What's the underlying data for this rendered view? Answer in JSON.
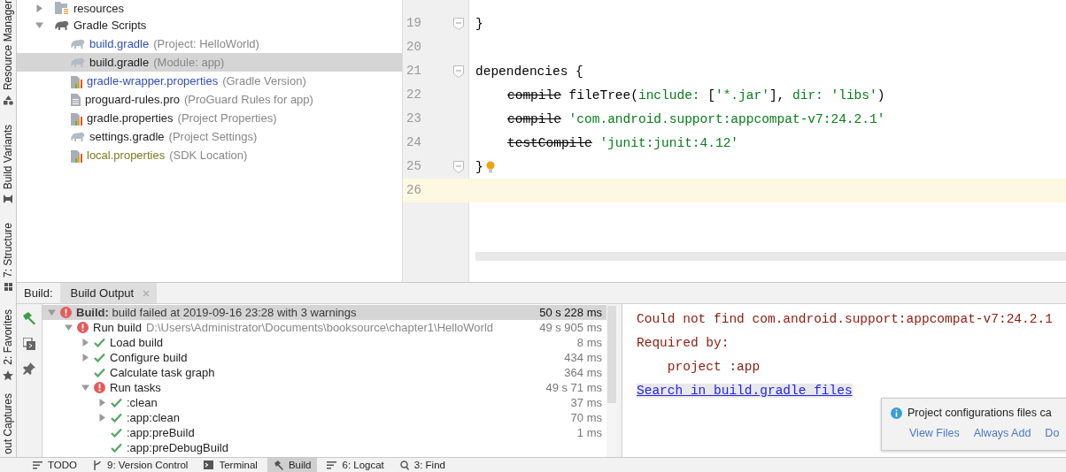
{
  "tool_strip": {
    "top": [
      {
        "label": "Resource Manager"
      },
      {
        "label": "Build Variants"
      },
      {
        "label": "7: Structure"
      }
    ],
    "bottom": [
      {
        "label": "2: Favorites"
      },
      {
        "label": "out Captures"
      }
    ]
  },
  "project_tree": [
    {
      "kind": "folder",
      "name": "resources",
      "expanded": false,
      "selected": false
    },
    {
      "kind": "group",
      "name": "Gradle Scripts",
      "expanded": true,
      "selected": false,
      "children": [
        {
          "kind": "gradle",
          "name": "build.gradle",
          "hint": "(Project: HelloWorld)",
          "color": "#2f4fb8",
          "selected": false
        },
        {
          "kind": "gradle",
          "name": "build.gradle",
          "hint": "(Module: app)",
          "color": "#222222",
          "selected": true
        },
        {
          "kind": "properties",
          "name": "gradle-wrapper.properties",
          "hint": "(Gradle Version)",
          "color": "#2f4fb8",
          "selected": false
        },
        {
          "kind": "text",
          "name": "proguard-rules.pro",
          "hint": "(ProGuard Rules for app)",
          "color": "#222222",
          "selected": false
        },
        {
          "kind": "properties",
          "name": "gradle.properties",
          "hint": "(Project Properties)",
          "color": "#222222",
          "selected": false
        },
        {
          "kind": "gradle",
          "name": "settings.gradle",
          "hint": "(Project Settings)",
          "color": "#222222",
          "selected": false
        },
        {
          "kind": "properties",
          "name": "local.properties",
          "hint": "(SDK Location)",
          "color": "#7d7a1f",
          "selected": false
        }
      ]
    }
  ],
  "editor": {
    "lines": [
      {
        "number": "19",
        "fold": true,
        "bulb": false,
        "current": false,
        "tokens": [
          {
            "kind": "plain",
            "text": "}"
          }
        ]
      },
      {
        "number": "20",
        "fold": false,
        "bulb": false,
        "current": false
      },
      {
        "number": "21",
        "fold": true,
        "bulb": false,
        "current": false,
        "tokens": [
          {
            "kind": "plain",
            "text": "dependencies {"
          }
        ]
      },
      {
        "number": "22",
        "fold": false,
        "bulb": false,
        "current": false,
        "indented": true,
        "tokens": [
          {
            "kind": "deprecated",
            "text": "compile"
          },
          {
            "kind": "plain",
            "text": " fileTree("
          },
          {
            "kind": "string",
            "text": "include: "
          },
          {
            "kind": "plain",
            "text": "["
          },
          {
            "kind": "string",
            "text": "'*.jar'"
          },
          {
            "kind": "plain",
            "text": "], "
          },
          {
            "kind": "string",
            "text": "dir: 'libs'"
          },
          {
            "kind": "plain",
            "text": ")"
          }
        ]
      },
      {
        "number": "23",
        "fold": false,
        "bulb": false,
        "current": false,
        "indented": true,
        "tokens": [
          {
            "kind": "deprecated",
            "text": "compile"
          },
          {
            "kind": "string",
            "text": " 'com.android.support:appcompat-v7:24.2.1'"
          }
        ]
      },
      {
        "number": "24",
        "fold": false,
        "bulb": false,
        "current": false,
        "indented": true,
        "tokens": [
          {
            "kind": "deprecated",
            "text": "testCompile"
          },
          {
            "kind": "string",
            "text": " 'junit:junit:4.12'"
          }
        ]
      },
      {
        "number": "25",
        "fold": true,
        "bulb": true,
        "current": false,
        "tokens": [
          {
            "kind": "plain",
            "text": "}"
          }
        ]
      },
      {
        "number": "26",
        "fold": false,
        "bulb": false,
        "current": true
      }
    ]
  },
  "build_panel": {
    "label": "Build:",
    "tabs": [
      {
        "label": "Build Output",
        "selected": true
      }
    ],
    "tree": [
      {
        "kind": "error",
        "text": "**Build:** build failed at 2019-09-16 23:28  with 3 warnings",
        "time": "50 s 228 ms",
        "expanded": true,
        "selected": true,
        "children": [
          {
            "kind": "error",
            "text": "Run build",
            "detail": "D:\\Users\\Administrator\\Documents\\booksource\\chapter1\\HelloWorld",
            "time": "49 s 905 ms",
            "expanded": true,
            "selected": false,
            "children": [
              {
                "kind": "success",
                "text": "Load build",
                "time": "8 ms",
                "expanded": false,
                "selected": false
              },
              {
                "kind": "success",
                "text": "Configure build",
                "time": "434 ms",
                "expanded": false,
                "selected": false
              },
              {
                "kind": "success",
                "text": "Calculate task graph",
                "time": "364 ms",
                "selected": false
              },
              {
                "kind": "error",
                "text": "Run tasks",
                "time": "49 s 71 ms",
                "expanded": true,
                "selected": false,
                "children": [
                  {
                    "kind": "success",
                    "text": ":clean",
                    "time": "37 ms",
                    "expanded": false,
                    "selected": false
                  },
                  {
                    "kind": "success",
                    "text": ":app:clean",
                    "time": "70 ms",
                    "expanded": false,
                    "selected": false
                  },
                  {
                    "kind": "success",
                    "text": ":app:preBuild",
                    "time": "1 ms",
                    "selected": false
                  },
                  {
                    "kind": "success",
                    "text": ":app:preDebugBuild",
                    "selected": false
                  }
                ]
              }
            ]
          }
        ]
      }
    ],
    "console": [
      {
        "kind": "error",
        "text": "Could not find com.android.support:appcompat-v7:24.2.1"
      },
      {
        "kind": "error",
        "text": "Required by:"
      },
      {
        "kind": "error",
        "text": "    project :app"
      },
      {
        "kind": "link",
        "text": "Search in build.gradle files"
      }
    ]
  },
  "notification": {
    "text": "Project configurations files ca",
    "actions": [
      "View Files",
      "Always Add",
      "Do"
    ]
  },
  "bottom_bar": [
    {
      "label": "TODO",
      "selected": false
    },
    {
      "label": "9: Version Control",
      "selected": false
    },
    {
      "label": "Terminal",
      "selected": false
    },
    {
      "label": "Build",
      "selected": true
    },
    {
      "label": "6: Logcat",
      "selected": false
    },
    {
      "label": "3: Find",
      "selected": false
    }
  ]
}
